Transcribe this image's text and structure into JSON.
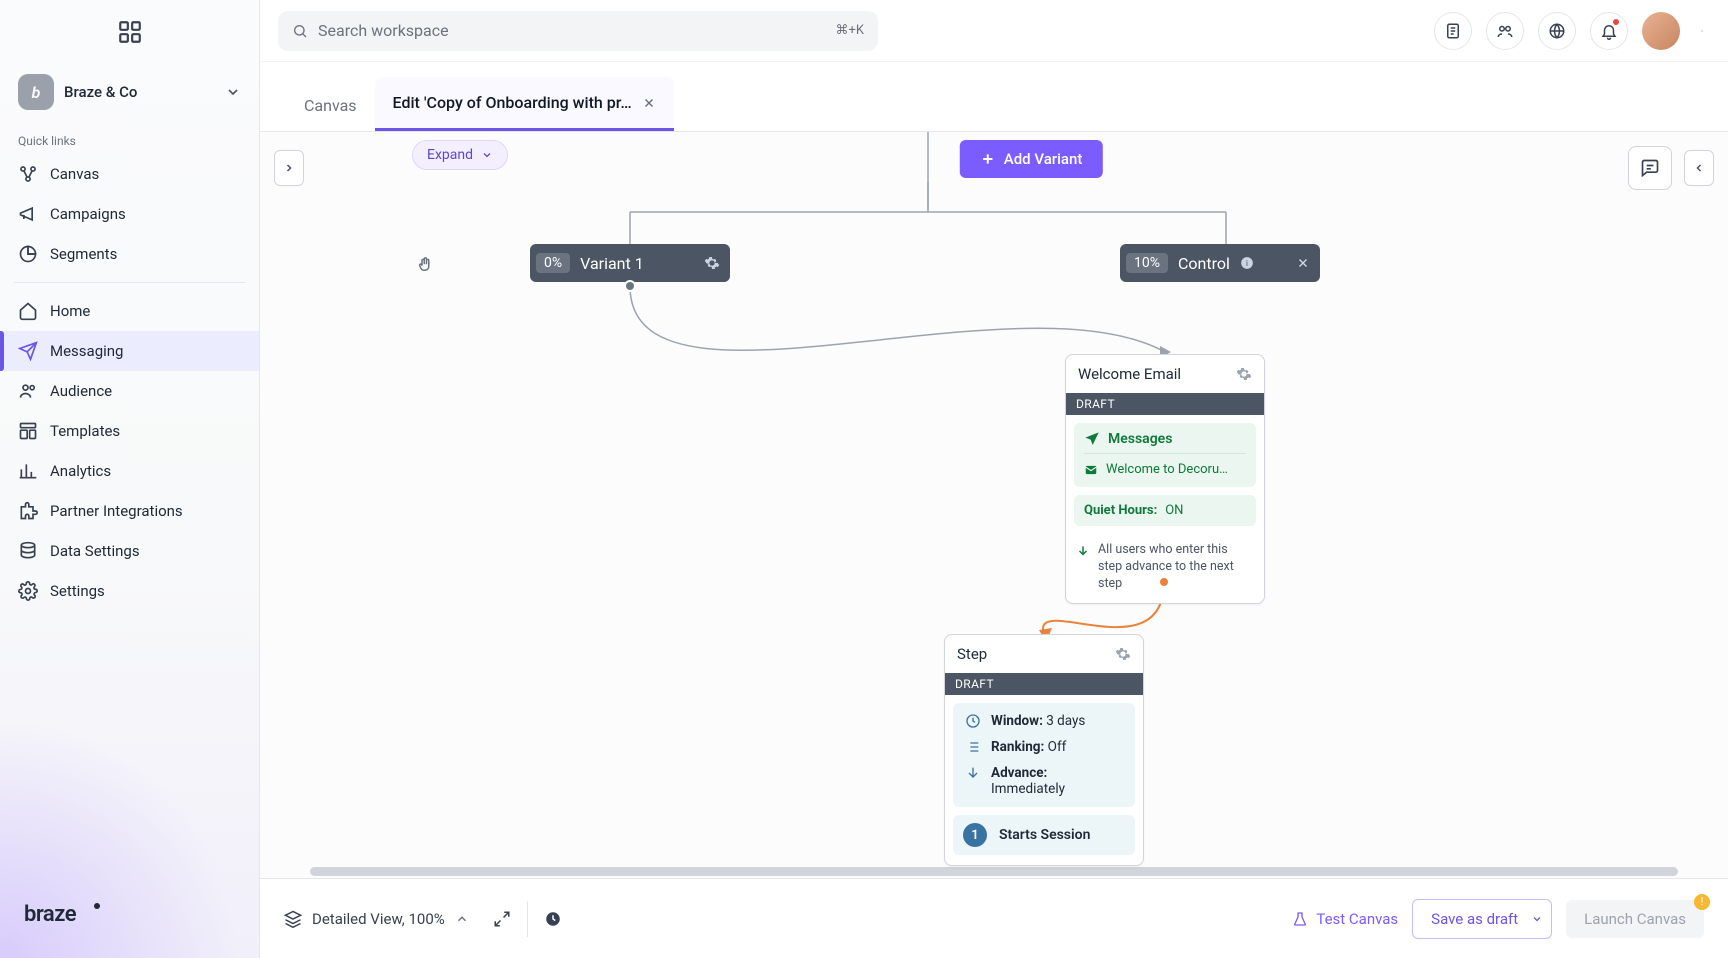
{
  "workspace": {
    "name": "Braze & Co",
    "badge": "b"
  },
  "quick_links_label": "Quick links",
  "nav": {
    "canvas": "Canvas",
    "campaigns": "Campaigns",
    "segments": "Segments",
    "home": "Home",
    "messaging": "Messaging",
    "audience": "Audience",
    "templates": "Templates",
    "analytics": "Analytics",
    "partner": "Partner Integrations",
    "data_settings": "Data Settings",
    "settings": "Settings"
  },
  "search": {
    "placeholder": "Search workspace",
    "shortcut": "⌘+K"
  },
  "tabs": {
    "canvas": "Canvas",
    "edit": "Edit 'Copy of Onboarding with pr…"
  },
  "toolbar": {
    "expand": "Expand",
    "add_variant": "Add Variant"
  },
  "variant1": {
    "pct": "0%",
    "label": "Variant 1"
  },
  "control": {
    "pct": "10%",
    "label": "Control"
  },
  "card1": {
    "title": "Welcome Email",
    "draft": "DRAFT",
    "messages_label": "Messages",
    "message_name": "Welcome to Decoru…",
    "quiet_label": "Quiet Hours:",
    "quiet_value": "ON",
    "advance_note": "All users who enter this step advance to the next step"
  },
  "card2": {
    "title": "Step",
    "draft": "DRAFT",
    "window_label": "Window:",
    "window_value": "3 days",
    "ranking_label": "Ranking:",
    "ranking_value": "Off",
    "advance_label": "Advance:",
    "advance_value": "Immediately",
    "action_num": "1",
    "action_label": "Starts Session"
  },
  "footer": {
    "view_label": "Detailed View, 100%",
    "test": "Test Canvas",
    "save": "Save as draft",
    "launch": "Launch Canvas"
  }
}
